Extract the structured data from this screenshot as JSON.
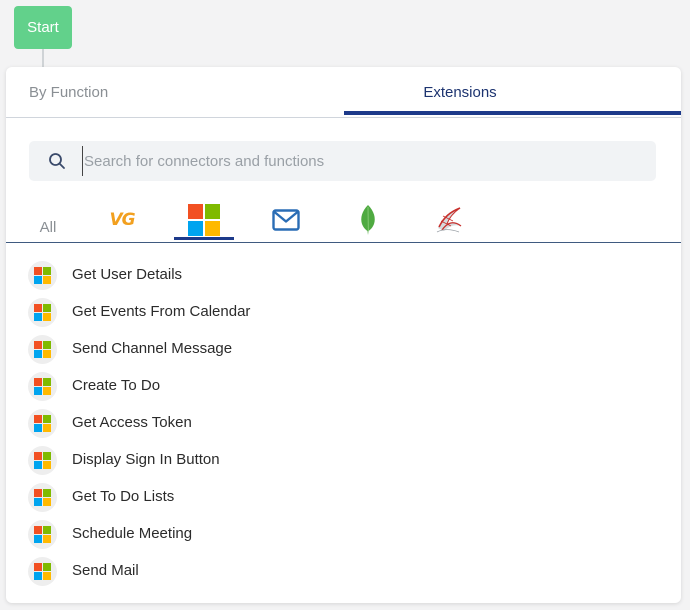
{
  "start_node": {
    "label": "Start"
  },
  "tabs": {
    "by_function": "By Function",
    "extensions": "Extensions",
    "active": "Extensions"
  },
  "search": {
    "placeholder": "Search for connectors and functions",
    "value": ""
  },
  "categories": {
    "all_label": "All",
    "vg_logo_text": "VG",
    "items": [
      {
        "name": "all",
        "icon": "none"
      },
      {
        "name": "vg",
        "icon": "vg-logo-icon"
      },
      {
        "name": "microsoft",
        "icon": "microsoft-icon",
        "active": true
      },
      {
        "name": "mail",
        "icon": "mail-icon"
      },
      {
        "name": "mongodb",
        "icon": "mongodb-leaf-icon"
      },
      {
        "name": "sql-server",
        "icon": "sql-server-icon"
      }
    ]
  },
  "functions": [
    {
      "label": "Get User Details",
      "icon": "microsoft-icon"
    },
    {
      "label": "Get Events From Calendar",
      "icon": "microsoft-icon"
    },
    {
      "label": "Send Channel Message",
      "icon": "microsoft-icon"
    },
    {
      "label": "Create To Do",
      "icon": "microsoft-icon"
    },
    {
      "label": "Get Access Token",
      "icon": "microsoft-icon"
    },
    {
      "label": "Display Sign In Button",
      "icon": "microsoft-icon"
    },
    {
      "label": "Get To Do Lists",
      "icon": "microsoft-icon"
    },
    {
      "label": "Schedule Meeting",
      "icon": "microsoft-icon"
    },
    {
      "label": "Send Mail",
      "icon": "microsoft-icon"
    }
  ],
  "colors": {
    "start_green": "#62d18b",
    "accent_navy": "#1d3a8a",
    "ms_red": "#f25022",
    "ms_green": "#7fba00",
    "ms_blue": "#00a4ef",
    "ms_yellow": "#ffb900",
    "vg_orange": "#f2a01f",
    "mail_blue": "#2a6db5",
    "mongo_green": "#4faa41",
    "sql_red": "#c8302c"
  }
}
